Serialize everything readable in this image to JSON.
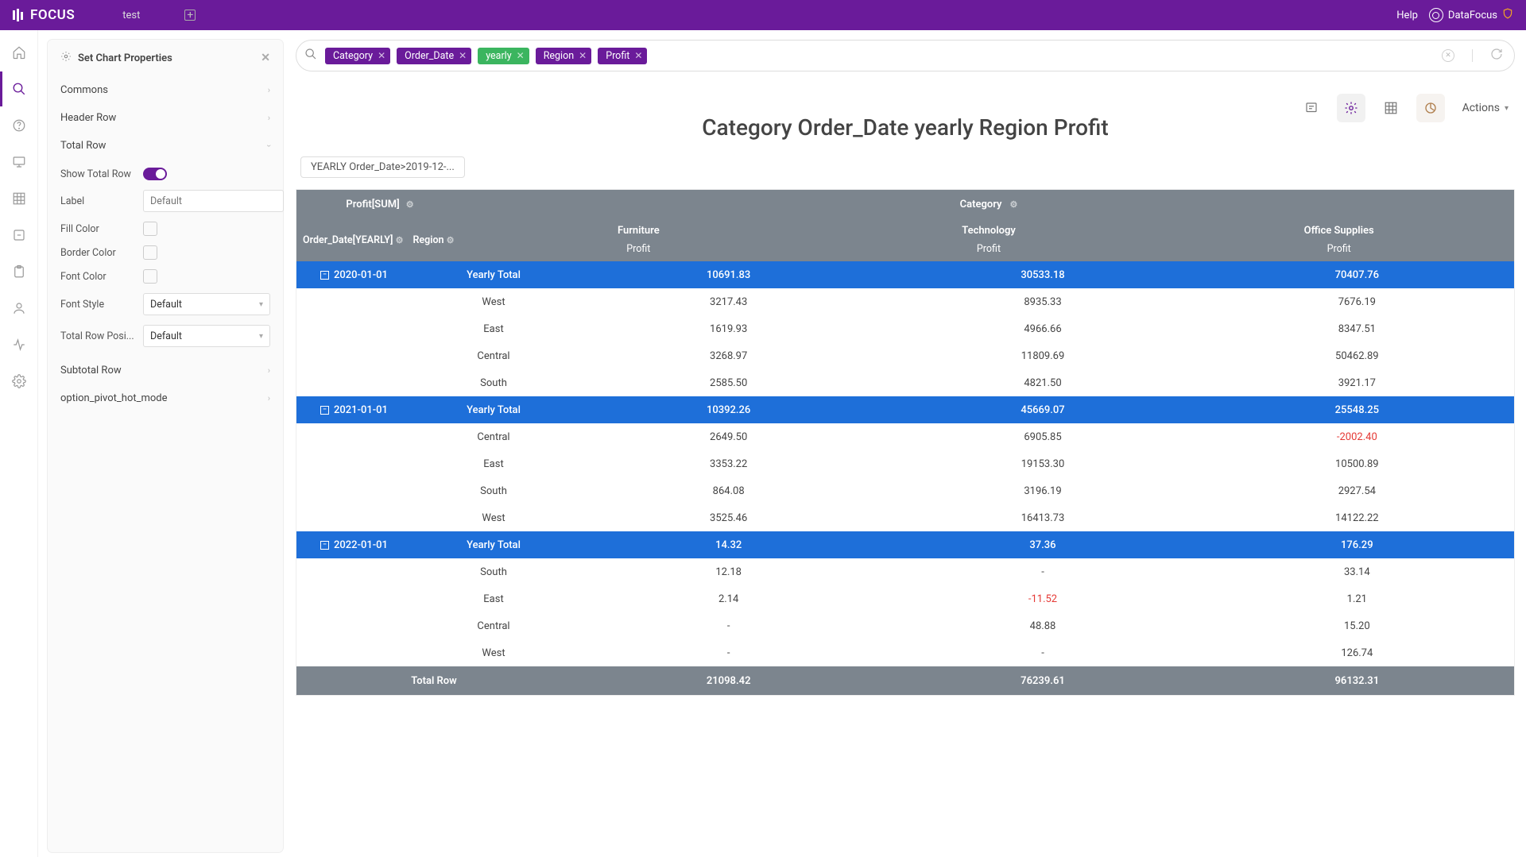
{
  "topbar": {
    "brand": "FOCUS",
    "tab": "test",
    "help": "Help",
    "user": "DataFocus"
  },
  "props": {
    "title": "Set Chart Properties",
    "sections": {
      "commons": "Commons",
      "header_row": "Header Row",
      "total_row": "Total Row",
      "subtotal_row": "Subtotal Row",
      "pivot_mode": "option_pivot_hot_mode"
    },
    "fields": {
      "show_total_row": "Show Total Row",
      "label": "Label",
      "label_placeholder": "Default",
      "fill_color": "Fill Color",
      "border_color": "Border Color",
      "font_color": "Font Color",
      "font_style": "Font Style",
      "font_style_value": "Default",
      "total_row_pos": "Total Row Posi...",
      "total_row_pos_value": "Default"
    }
  },
  "query": {
    "chips": [
      "Category",
      "Order_Date",
      "yearly",
      "Region",
      "Profit"
    ]
  },
  "main": {
    "title": "Category Order_Date yearly Region Profit",
    "filter_chip": "YEARLY Order_Date>2019-12-...",
    "actions_label": "Actions"
  },
  "table": {
    "header_left": "Profit[SUM]",
    "header_right": "Category",
    "col_date": "Order_Date[YEARLY]",
    "col_region": "Region",
    "categories": [
      "Furniture",
      "Technology",
      "Office Supplies"
    ],
    "sub_label": "Profit",
    "yearly_total_label": "Yearly Total",
    "total_row_label": "Total Row",
    "groups": [
      {
        "date": "2020-01-01",
        "totals": [
          "10691.83",
          "30533.18",
          "70407.76"
        ],
        "rows": [
          {
            "region": "West",
            "v": [
              "3217.43",
              "8935.33",
              "7676.19"
            ]
          },
          {
            "region": "East",
            "v": [
              "1619.93",
              "4966.66",
              "8347.51"
            ]
          },
          {
            "region": "Central",
            "v": [
              "3268.97",
              "11809.69",
              "50462.89"
            ]
          },
          {
            "region": "South",
            "v": [
              "2585.50",
              "4821.50",
              "3921.17"
            ]
          }
        ]
      },
      {
        "date": "2021-01-01",
        "totals": [
          "10392.26",
          "45669.07",
          "25548.25"
        ],
        "rows": [
          {
            "region": "Central",
            "v": [
              "2649.50",
              "6905.85",
              "-2002.40"
            ]
          },
          {
            "region": "East",
            "v": [
              "3353.22",
              "19153.30",
              "10500.89"
            ]
          },
          {
            "region": "South",
            "v": [
              "864.08",
              "3196.19",
              "2927.54"
            ]
          },
          {
            "region": "West",
            "v": [
              "3525.46",
              "16413.73",
              "14122.22"
            ]
          }
        ]
      },
      {
        "date": "2022-01-01",
        "totals": [
          "14.32",
          "37.36",
          "176.29"
        ],
        "rows": [
          {
            "region": "South",
            "v": [
              "12.18",
              "-",
              "33.14"
            ]
          },
          {
            "region": "East",
            "v": [
              "2.14",
              "-11.52",
              "1.21"
            ]
          },
          {
            "region": "Central",
            "v": [
              "-",
              "48.88",
              "15.20"
            ]
          },
          {
            "region": "West",
            "v": [
              "-",
              "-",
              "126.74"
            ]
          }
        ]
      }
    ],
    "grand_total": [
      "21098.42",
      "76239.61",
      "96132.31"
    ]
  },
  "chart_data": {
    "type": "table",
    "title": "Category Order_Date yearly Region Profit",
    "measure": "Profit (SUM)",
    "columns": [
      "Furniture",
      "Technology",
      "Office Supplies"
    ],
    "rows": [
      {
        "year": "2020-01-01",
        "region": "West",
        "values": [
          3217.43,
          8935.33,
          7676.19
        ]
      },
      {
        "year": "2020-01-01",
        "region": "East",
        "values": [
          1619.93,
          4966.66,
          8347.51
        ]
      },
      {
        "year": "2020-01-01",
        "region": "Central",
        "values": [
          3268.97,
          11809.69,
          50462.89
        ]
      },
      {
        "year": "2020-01-01",
        "region": "South",
        "values": [
          2585.5,
          4821.5,
          3921.17
        ]
      },
      {
        "year": "2021-01-01",
        "region": "Central",
        "values": [
          2649.5,
          6905.85,
          -2002.4
        ]
      },
      {
        "year": "2021-01-01",
        "region": "East",
        "values": [
          3353.22,
          19153.3,
          10500.89
        ]
      },
      {
        "year": "2021-01-01",
        "region": "South",
        "values": [
          864.08,
          3196.19,
          2927.54
        ]
      },
      {
        "year": "2021-01-01",
        "region": "West",
        "values": [
          3525.46,
          16413.73,
          14122.22
        ]
      },
      {
        "year": "2022-01-01",
        "region": "South",
        "values": [
          12.18,
          null,
          33.14
        ]
      },
      {
        "year": "2022-01-01",
        "region": "East",
        "values": [
          2.14,
          -11.52,
          1.21
        ]
      },
      {
        "year": "2022-01-01",
        "region": "Central",
        "values": [
          null,
          48.88,
          15.2
        ]
      },
      {
        "year": "2022-01-01",
        "region": "West",
        "values": [
          null,
          null,
          126.74
        ]
      }
    ],
    "year_totals": {
      "2020-01-01": [
        10691.83,
        30533.18,
        70407.76
      ],
      "2021-01-01": [
        10392.26,
        45669.07,
        25548.25
      ],
      "2022-01-01": [
        14.32,
        37.36,
        176.29
      ]
    },
    "grand_total": [
      21098.42,
      76239.61,
      96132.31
    ]
  }
}
